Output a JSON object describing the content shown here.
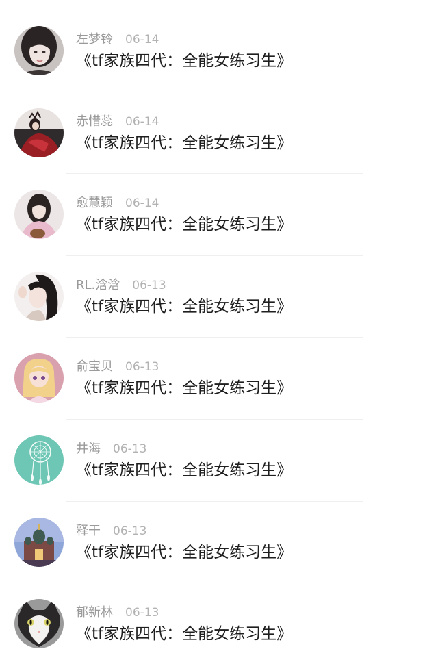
{
  "feed": {
    "items": [
      {
        "name": "左梦铃",
        "date": "06-14",
        "title": "《tf家族四代：全能女练习生》",
        "avatar": "avatar-girl-portrait"
      },
      {
        "name": "赤惜蕊",
        "date": "06-14",
        "title": "《tf家族四代：全能女练习生》",
        "avatar": "avatar-red-dress"
      },
      {
        "name": "愈慧颖",
        "date": "06-14",
        "title": "《tf家族四代：全能女练习生》",
        "avatar": "avatar-girl-pink"
      },
      {
        "name": "RL.浛浛",
        "date": "06-13",
        "title": "《tf家族四代：全能女练习生》",
        "avatar": "avatar-girl-selfie"
      },
      {
        "name": "俞宝贝",
        "date": "06-13",
        "title": "《tf家族四代：全能女练习生》",
        "avatar": "avatar-anime-girl"
      },
      {
        "name": "井海",
        "date": "06-13",
        "title": "《tf家族四代：全能女练习生》",
        "avatar": "avatar-dreamcatcher"
      },
      {
        "name": "释干",
        "date": "06-13",
        "title": "《tf家族四代：全能女练习生》",
        "avatar": "avatar-cathedral"
      },
      {
        "name": "郁新林",
        "date": "06-13",
        "title": "《tf家族四代：全能女练习生》",
        "avatar": "avatar-cat"
      }
    ]
  }
}
